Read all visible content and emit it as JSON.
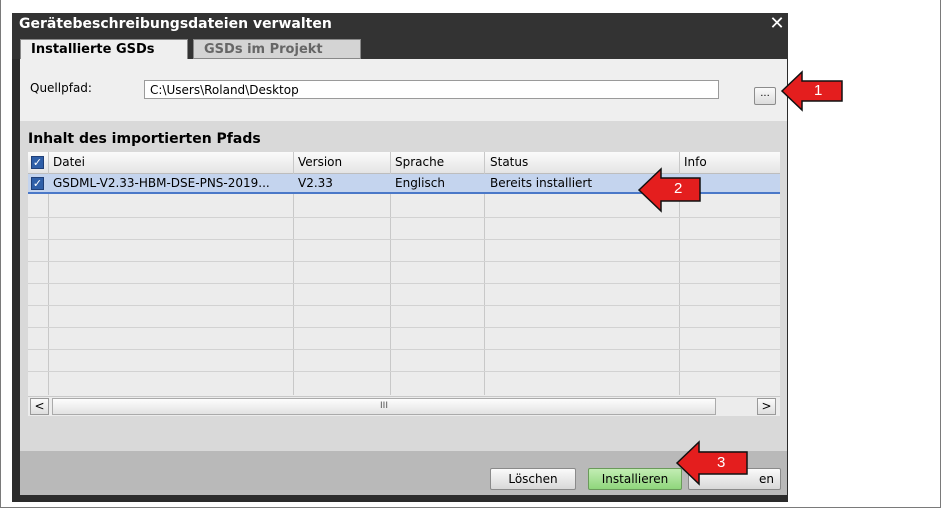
{
  "dialog": {
    "title": "Gerätebeschreibungsdateien verwalten",
    "close_glyph": "✕",
    "tabs": [
      {
        "label": "Installierte GSDs",
        "active": true
      },
      {
        "label": "GSDs im Projekt",
        "active": false
      }
    ],
    "source": {
      "label": "Quellpfad:",
      "value": "C:\\Users\\Roland\\Desktop",
      "browse_label": "..."
    },
    "section_title": "Inhalt des importierten Pfads",
    "table": {
      "columns": [
        "Datei",
        "Version",
        "Sprache",
        "Status",
        "Info"
      ],
      "rows": [
        {
          "checked": true,
          "file": "GSDML-V2.33-HBM-DSE-PNS-2019...",
          "version": "V2.33",
          "language": "Englisch",
          "status": "Bereits installiert",
          "info": ""
        }
      ]
    },
    "scrollbar": {
      "left_glyph": "<",
      "right_glyph": ">",
      "thumb_glyph": "III"
    },
    "buttons": {
      "delete": "Löschen",
      "install": "Installieren",
      "close_partial": "en"
    }
  },
  "annotations": [
    {
      "number": "1",
      "color": "#e41e1e"
    },
    {
      "number": "2",
      "color": "#e41e1e"
    },
    {
      "number": "3",
      "color": "#e41e1e"
    }
  ],
  "colors": {
    "title_bg": "#333333",
    "selection": "#c4d4ee",
    "install_button": "#8fd67c"
  }
}
